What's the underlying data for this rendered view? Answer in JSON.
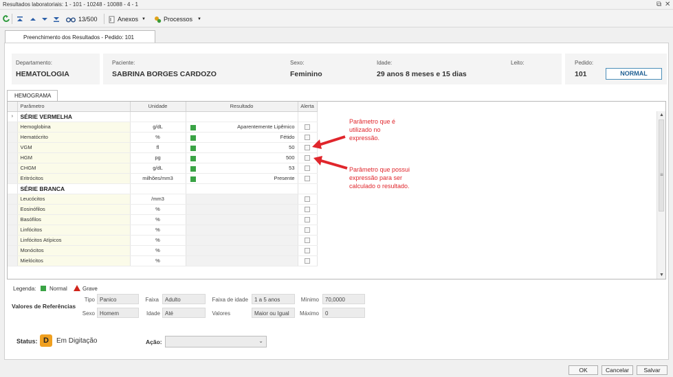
{
  "window": {
    "title": "Resultados laboratoriais: 1 - 101 - 10248 - 10088 - 4 - 1",
    "restore_glyph": "⧉",
    "close_glyph": "✕"
  },
  "toolbar": {
    "record_counter": "13/500",
    "anexos_label": "Anexos",
    "processos_label": "Processos"
  },
  "tab": {
    "label": "Preenchimento dos Resultados - Pedido: 101"
  },
  "header": {
    "departamento_label": "Departamento:",
    "departamento_value": "HEMATOLOGIA",
    "paciente_label": "Paciente:",
    "paciente_value": "SABRINA BORGES CARDOZO",
    "sexo_label": "Sexo:",
    "sexo_value": "Feminino",
    "idade_label": "Idade:",
    "idade_value": "29 anos 8 meses  e 15 dias",
    "leito_label": "Leito:",
    "pedido_label": "Pedido:",
    "pedido_value": "101",
    "status_badge": "NORMAL"
  },
  "subtab": {
    "label": "HEMOGRAMA"
  },
  "grid": {
    "columns": {
      "parametro": "Parâmetro",
      "unidade": "Unidade",
      "resultado": "Resultado",
      "alerta": "Alerta"
    },
    "rows": [
      {
        "type": "section",
        "name": "SÉRIE VERMELHA"
      },
      {
        "type": "item",
        "name": "Hemoglobina",
        "unit": "g/dL",
        "result": "Aparentemente Lipêmico",
        "flag": true
      },
      {
        "type": "item",
        "name": "Hematócrito",
        "unit": "%",
        "result": "Fétido",
        "flag": true
      },
      {
        "type": "item",
        "name": "VGM",
        "unit": "fl",
        "result": "50",
        "flag": true
      },
      {
        "type": "item",
        "name": "HGM",
        "unit": "pg",
        "result": "500",
        "flag": true
      },
      {
        "type": "item",
        "name": "CHGM",
        "unit": "g/dL",
        "result": "53",
        "flag": true
      },
      {
        "type": "item",
        "name": "Eritrócitos",
        "unit": "milhões/mm3",
        "result": "Presente",
        "flag": true
      },
      {
        "type": "section",
        "name": "SÉRIE BRANCA"
      },
      {
        "type": "item",
        "name": "Leucócitos",
        "unit": "/mm3",
        "result": "",
        "flag": false
      },
      {
        "type": "item",
        "name": "Eosinófilos",
        "unit": "%",
        "result": "",
        "flag": false
      },
      {
        "type": "item",
        "name": "Basófilos",
        "unit": "%",
        "result": "",
        "flag": false
      },
      {
        "type": "item",
        "name": "Linfócitos",
        "unit": "%",
        "result": "",
        "flag": false
      },
      {
        "type": "item",
        "name": "Linfócitos Atípicos",
        "unit": "%",
        "result": "",
        "flag": false
      },
      {
        "type": "item",
        "name": "Monócitos",
        "unit": "%",
        "result": "",
        "flag": false
      },
      {
        "type": "item",
        "name": "Mielócitos",
        "unit": "%",
        "result": "",
        "flag": false
      }
    ]
  },
  "annotations": {
    "first_lines": [
      "Parâmetro que é",
      "utilizado no",
      "expressão."
    ],
    "second_lines": [
      "Parâmetro que possui",
      "expressão para ser",
      "calculado o resultado."
    ]
  },
  "legend": {
    "label": "Legenda:",
    "normal": "Normal",
    "grave": "Grave"
  },
  "references": {
    "title": "Valores de Referências",
    "tipo_label": "Tipo",
    "tipo_value": "Panico",
    "faixa_label": "Faixa",
    "faixa_value": "Adulto",
    "faixa_idade_label": "Faixa de idade",
    "faixa_idade_value": "1 a 5 anos",
    "minimo_label": "Mínimo",
    "minimo_value": "70,0000",
    "sexo_label": "Sexo",
    "sexo_value": "Homem",
    "idade_label": "Idade",
    "idade_value": "Até",
    "valores_label": "Valores",
    "valores_value": "Maior ou Igual",
    "maximo_label": "Máximo",
    "maximo_value": "0"
  },
  "status": {
    "label": "Status:",
    "badge": "D",
    "value": "Em Digitação"
  },
  "acao": {
    "label": "Ação:",
    "value": ""
  },
  "buttons": {
    "ok": "OK",
    "cancelar": "Cancelar",
    "salvar": "Salvar"
  },
  "colors": {
    "normal": "#3aa345",
    "grave": "#d0241a",
    "annotation": "#e0262c",
    "status_badge": "#f0a020"
  }
}
